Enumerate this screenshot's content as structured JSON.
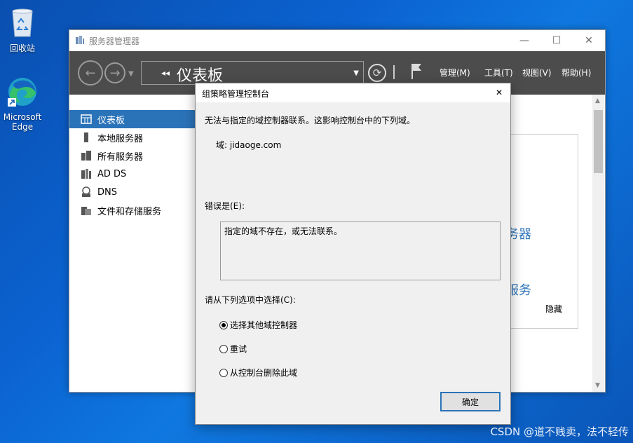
{
  "desktop": {
    "icons": [
      {
        "label": "回收站"
      },
      {
        "label": "Microsoft Edge"
      }
    ],
    "watermark": "CSDN @道不贱卖，法不轻传"
  },
  "server_manager": {
    "title": "服务器管理器",
    "breadcrumb": "仪表板",
    "menus": [
      "管理(M)",
      "工具(T)",
      "视图(V)",
      "帮助(H)"
    ],
    "sidebar": [
      {
        "label": "仪表板",
        "icon": "dashboard-icon",
        "active": true
      },
      {
        "label": "本地服务器",
        "icon": "server-icon"
      },
      {
        "label": "所有服务器",
        "icon": "servers-icon"
      },
      {
        "label": "AD DS",
        "icon": "ad-ds-icon"
      },
      {
        "label": "DNS",
        "icon": "dns-icon"
      },
      {
        "label": "文件和存储服务",
        "icon": "storage-icon"
      }
    ],
    "card": {
      "text1": "务器",
      "text2": "服务",
      "hide": "隐藏"
    }
  },
  "dialog": {
    "title": "组策略管理控制台",
    "message": "无法与指定的域控制器联系。这影响控制台中的下列域。",
    "domain": "域: jidaoge.com",
    "error_label": "错误是(E):",
    "error_text": "指定的域不存在，或无法联系。",
    "choose_label": "请从下列选项中选择(C):",
    "options": [
      {
        "label": "选择其他域控制器",
        "selected": true
      },
      {
        "label": "重试",
        "selected": false
      },
      {
        "label": "从控制台删除此域",
        "selected": false
      }
    ],
    "ok_label": "确定"
  }
}
